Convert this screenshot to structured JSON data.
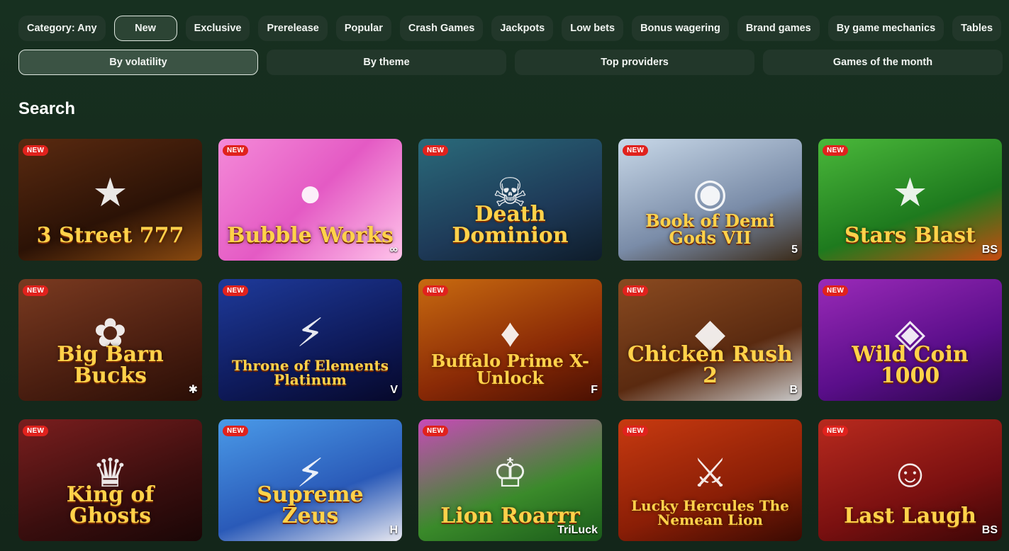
{
  "filters": {
    "chips": [
      {
        "label": "Category: Any",
        "active": false
      },
      {
        "label": "New",
        "active": true
      },
      {
        "label": "Exclusive",
        "active": false
      },
      {
        "label": "Prerelease",
        "active": false
      },
      {
        "label": "Popular",
        "active": false
      },
      {
        "label": "Crash Games",
        "active": false
      },
      {
        "label": "Jackpots",
        "active": false
      },
      {
        "label": "Low bets",
        "active": false
      },
      {
        "label": "Bonus wagering",
        "active": false
      },
      {
        "label": "Brand games",
        "active": false
      },
      {
        "label": "By game mechanics",
        "active": false
      },
      {
        "label": "Tables",
        "active": false
      }
    ],
    "wide": [
      {
        "label": "By volatility",
        "active": true
      },
      {
        "label": "By theme",
        "active": false
      },
      {
        "label": "Top providers",
        "active": false
      },
      {
        "label": "Games of the month",
        "active": false
      }
    ]
  },
  "section": {
    "title": "Search"
  },
  "badge_label": "NEW",
  "games": [
    {
      "title": "3 Street 777",
      "bg": "linear-gradient(160deg,#5a2a10,#2b1206 60%,#8a4a10)",
      "deco": "★",
      "provider": ""
    },
    {
      "title": "Bubble Works",
      "bg": "linear-gradient(135deg,#f48ad8,#e45ac4 50%,#ffc4ea)",
      "deco": "●",
      "provider": "∞"
    },
    {
      "title": "Death Dominion",
      "bg": "linear-gradient(160deg,#2a6a7a,#1e3a58 60%,#0e1c2a)",
      "deco": "☠",
      "provider": ""
    },
    {
      "title": "Book of Demi Gods VII",
      "bg": "linear-gradient(160deg,#c8d8e8,#7a8ca8 60%,#3a2a18)",
      "deco": "◉",
      "provider": "5"
    },
    {
      "title": "Stars Blast",
      "bg": "linear-gradient(160deg,#4ab83a,#1e7a1e 60%,#c84a10)",
      "deco": "★",
      "provider": "BS"
    },
    {
      "title": "Big Barn Bucks",
      "bg": "linear-gradient(160deg,#7a3a20,#4a1e10 60%,#2a0e06)",
      "deco": "✿",
      "provider": "✱"
    },
    {
      "title": "Throne of Elements Platinum",
      "bg": "linear-gradient(160deg,#1e3a9a,#0e1a5a 60%,#06082a)",
      "deco": "⚡",
      "provider": "V"
    },
    {
      "title": "Buffalo Prime X-Unlock",
      "bg": "linear-gradient(160deg,#c86a10,#8a2a06 60%,#4a1002)",
      "deco": "♦",
      "provider": "F"
    },
    {
      "title": "Chicken Rush 2",
      "bg": "linear-gradient(160deg,#8a4a20,#5a2a10 60%,#c8c8c8)",
      "deco": "◆",
      "provider": "B"
    },
    {
      "title": "Wild Coin 1000",
      "bg": "linear-gradient(160deg,#9a2ab8,#5a0e8a 60%,#2a0648)",
      "deco": "◈",
      "provider": ""
    },
    {
      "title": "King of Ghosts",
      "bg": "linear-gradient(160deg,#7a1e1e,#3a0e0e 60%,#1a0606)",
      "deco": "♛",
      "provider": ""
    },
    {
      "title": "Supreme Zeus",
      "bg": "linear-gradient(160deg,#4a9ae8,#2a5ab8 60%,#e8e8f0)",
      "deco": "⚡",
      "provider": "H"
    },
    {
      "title": "Lion Roarrr",
      "bg": "linear-gradient(160deg,#c84ab8,#3a8a2a 60%,#1a5a1a)",
      "deco": "♔",
      "provider": "TriLuck"
    },
    {
      "title": "Lucky Hercules The Nemean Lion",
      "bg": "linear-gradient(160deg,#c83a10,#8a1e06 60%,#3a0a02)",
      "deco": "⚔",
      "provider": ""
    },
    {
      "title": "Last Laugh",
      "bg": "linear-gradient(160deg,#b82a1e,#7a1010 60%,#3a0606)",
      "deco": "☺",
      "provider": "BS"
    }
  ]
}
